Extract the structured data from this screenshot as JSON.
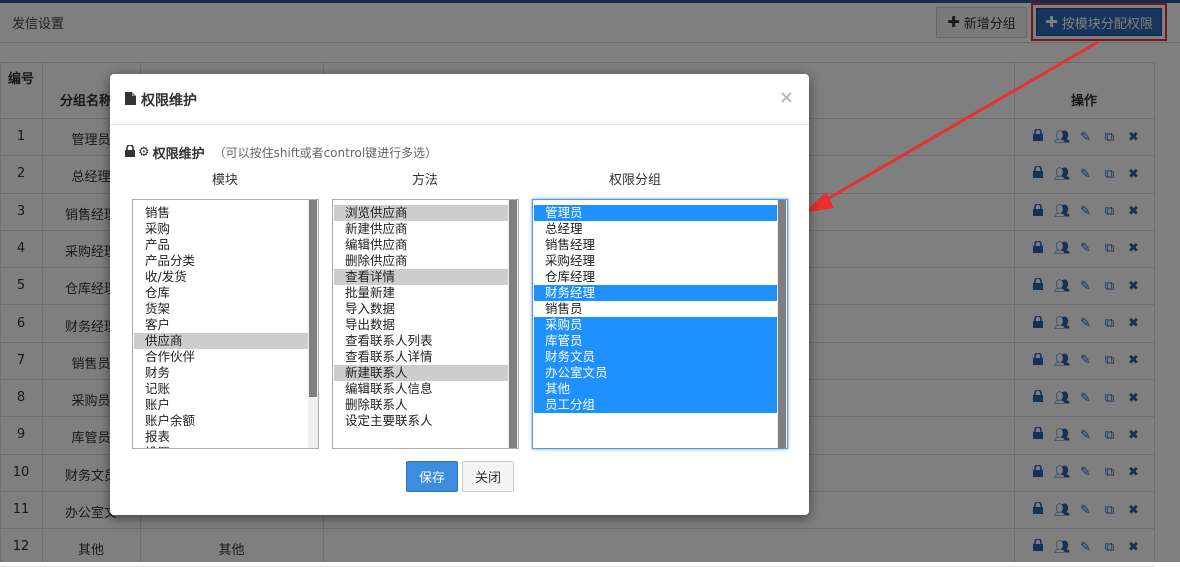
{
  "page": {
    "title": "发信设置"
  },
  "toolbar": {
    "add_label": "新增分组",
    "assign_label": "按模块分配权限"
  },
  "table": {
    "headers": {
      "id": "编号",
      "name": "分组名称",
      "ops": "操作"
    },
    "rows": [
      {
        "id": "1",
        "name": "管理员",
        "name2": ""
      },
      {
        "id": "2",
        "name": "总经理",
        "name2": ""
      },
      {
        "id": "3",
        "name": "销售经理",
        "name2": ""
      },
      {
        "id": "4",
        "name": "采购经理",
        "name2": ""
      },
      {
        "id": "5",
        "name": "仓库经理",
        "name2": ""
      },
      {
        "id": "6",
        "name": "财务经理",
        "name2": ""
      },
      {
        "id": "7",
        "name": "销售员",
        "name2": ""
      },
      {
        "id": "8",
        "name": "采购员",
        "name2": ""
      },
      {
        "id": "9",
        "name": "库管员",
        "name2": ""
      },
      {
        "id": "10",
        "name": "财务文员",
        "name2": ""
      },
      {
        "id": "11",
        "name": "办公室文",
        "name2": ""
      },
      {
        "id": "12",
        "name": "其他",
        "name2": "其他"
      }
    ],
    "op_icons": [
      "lock-icon",
      "users-icon",
      "pencil-icon",
      "copy-icon",
      "times-icon"
    ]
  },
  "modal": {
    "title": "权限维护",
    "close": "×",
    "subtitle": "权限维护",
    "hint": "（可以按住shift或者control键进行多选）",
    "col_module": "模块",
    "col_method": "方法",
    "col_group": "权限分组",
    "modules": [
      "销售",
      "采购",
      "产品",
      "产品分类",
      "收/发货",
      "仓库",
      "货架",
      "客户",
      "供应商",
      "合作伙伴",
      "财务",
      "记账",
      "账户",
      "账户余额",
      "报表",
      "设置"
    ],
    "modules_selected": [
      8
    ],
    "methods": [
      "浏览供应商",
      "新建供应商",
      "编辑供应商",
      "删除供应商",
      "查看详情",
      "批量新建",
      "导入数据",
      "导出数据",
      "查看联系人列表",
      "查看联系人详情",
      "新建联系人",
      "编辑联系人信息",
      "删除联系人",
      "设定主要联系人"
    ],
    "methods_selected": [
      0,
      4,
      10
    ],
    "groups": [
      "管理员",
      "总经理",
      "销售经理",
      "采购经理",
      "仓库经理",
      "财务经理",
      "销售员",
      "采购员",
      "库管员",
      "财务文员",
      "办公室文员",
      "其他",
      "员工分组"
    ],
    "groups_selected": [
      0,
      5,
      7,
      8,
      9,
      10,
      11,
      12
    ],
    "save_label": "保存",
    "close_label": "关闭"
  },
  "colors": {
    "accent": "#2d68b8",
    "selection": "#1e90ff",
    "highlight_box": "#e8312f",
    "icon": "#2b62b0"
  }
}
